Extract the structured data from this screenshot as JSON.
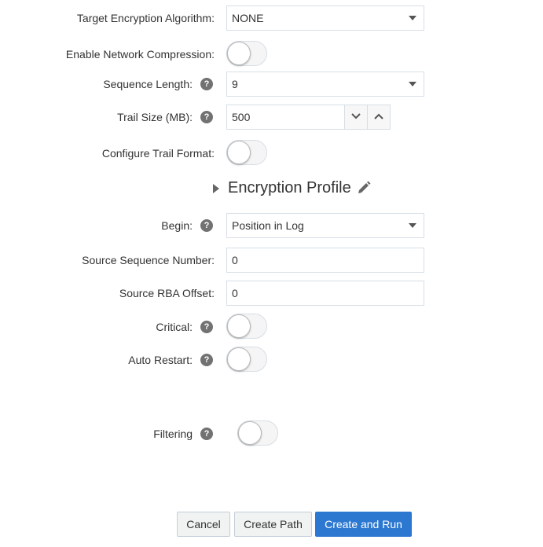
{
  "form": {
    "target_encryption": {
      "label": "Target Encryption Algorithm:",
      "value": "NONE"
    },
    "network_compression": {
      "label": "Enable Network Compression:",
      "on": false
    },
    "sequence_length": {
      "label": "Sequence Length:",
      "value": "9"
    },
    "trail_size": {
      "label": "Trail Size (MB):",
      "value": "500"
    },
    "trail_format": {
      "label": "Configure Trail Format:",
      "on": false
    },
    "encryption_profile": {
      "title": "Encryption Profile"
    },
    "begin": {
      "label": "Begin:",
      "value": "Position in Log"
    },
    "source_sequence": {
      "label": "Source Sequence Number:",
      "value": "0"
    },
    "source_rba": {
      "label": "Source RBA Offset:",
      "value": "0"
    },
    "critical": {
      "label": "Critical:",
      "on": false
    },
    "auto_restart": {
      "label": "Auto Restart:",
      "on": false
    },
    "filtering": {
      "label": "Filtering",
      "on": false
    }
  },
  "help_glyph": "?",
  "buttons": {
    "cancel": "Cancel",
    "create_path": "Create Path",
    "create_and_run": "Create and Run"
  },
  "colors": {
    "primary": "#2c77d0",
    "help_icon": "#727272",
    "border": "#d6dfe6"
  }
}
